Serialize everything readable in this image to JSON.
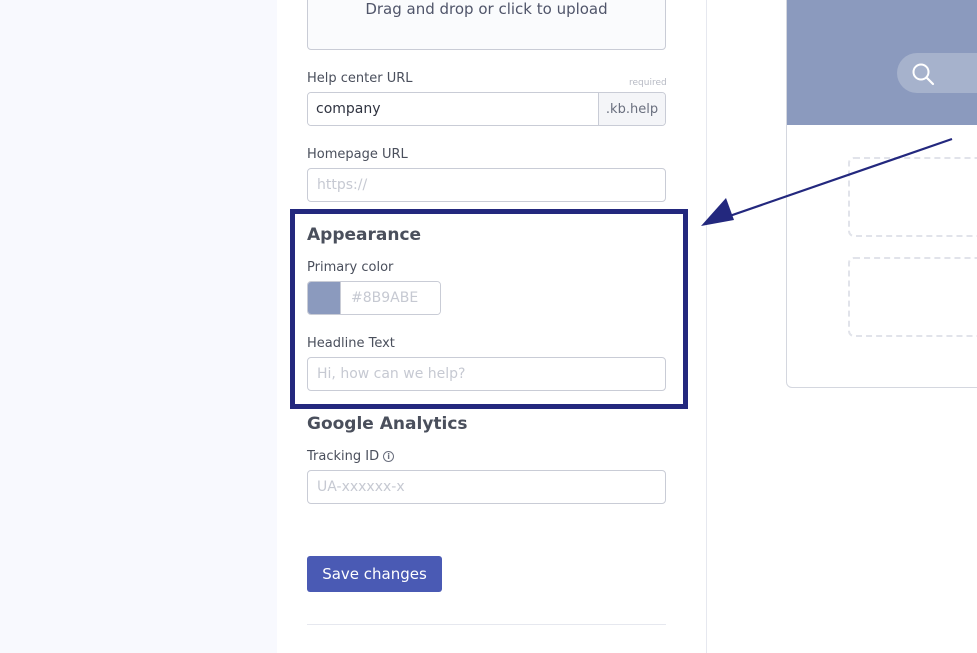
{
  "upload": {
    "text": "Drag and drop or click to upload"
  },
  "help_center": {
    "label": "Help center URL",
    "required": "required",
    "value": "company",
    "suffix": ".kb.help"
  },
  "homepage": {
    "label": "Homepage URL",
    "placeholder": "https://"
  },
  "appearance": {
    "heading": "Appearance",
    "primary_color_label": "Primary color",
    "primary_color_placeholder": "#8B9ABE",
    "swatch_color": "#8B9ABE",
    "headline_label": "Headline Text",
    "headline_placeholder": "Hi, how can we help?"
  },
  "analytics": {
    "heading": "Google Analytics",
    "tracking_label": "Tracking ID",
    "tracking_icon": "info-icon",
    "tracking_placeholder": "UA-xxxxxx-x"
  },
  "actions": {
    "save_label": "Save changes"
  },
  "colors": {
    "accent": "#4A5AB4",
    "highlight": "#23287E",
    "preview_header": "#8B9ABE"
  },
  "preview": {
    "search_icon": "search-icon"
  }
}
